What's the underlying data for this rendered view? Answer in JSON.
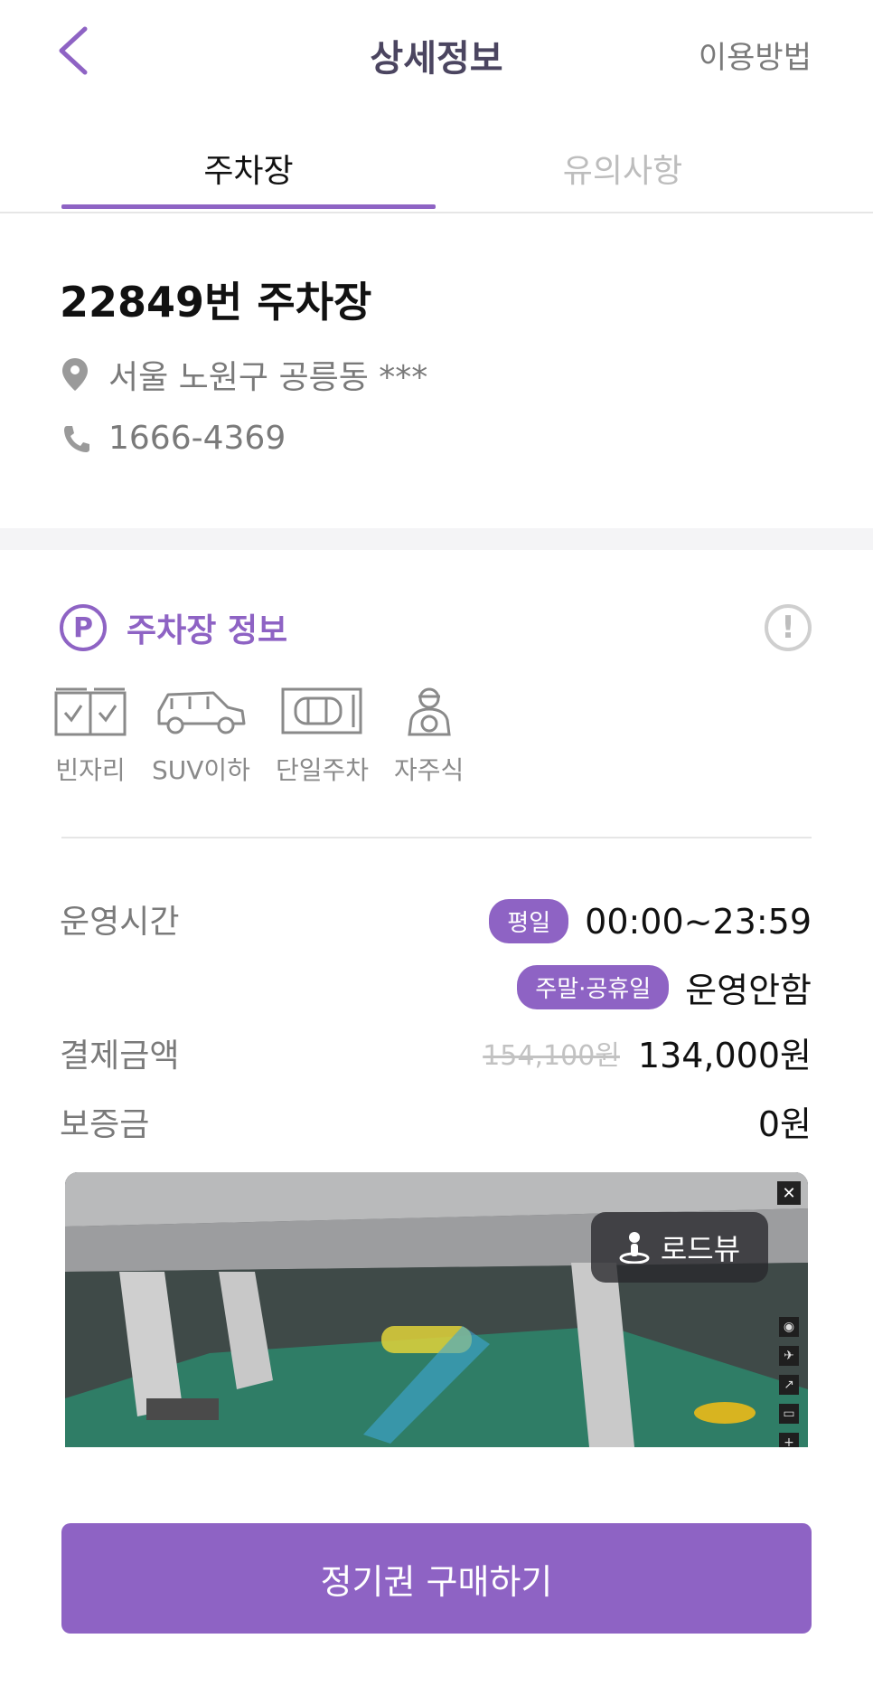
{
  "header": {
    "title": "상세정보",
    "usage_link": "이용방법"
  },
  "tabs": [
    {
      "label": "주차장"
    },
    {
      "label": "유의사항"
    }
  ],
  "lot": {
    "name": "22849번 주차장",
    "address": "서울 노원구 공릉동 ***",
    "phone": "1666-4369"
  },
  "section": {
    "badge": "P",
    "title": "주차장 정보",
    "features": [
      {
        "label": "빈자리",
        "icon": "vacancy-icon"
      },
      {
        "label": "SUV이하",
        "icon": "suv-icon"
      },
      {
        "label": "단일주차",
        "icon": "single-parking-icon"
      },
      {
        "label": "자주식",
        "icon": "self-parking-icon"
      }
    ]
  },
  "details": {
    "hours_label": "운영시간",
    "weekday_pill": "평일",
    "weekday_hours": "00:00~23:59",
    "weekend_pill": "주말·공휴일",
    "weekend_hours": "운영안함",
    "payment_label": "결제금액",
    "original_price": "154,100원",
    "price": "134,000원",
    "deposit_label": "보증금",
    "deposit": "0원"
  },
  "roadview": {
    "label": "로드뷰"
  },
  "cta": {
    "label": "정기권 구매하기"
  },
  "colors": {
    "accent": "#8e63c4",
    "muted": "#7a7a7a"
  }
}
